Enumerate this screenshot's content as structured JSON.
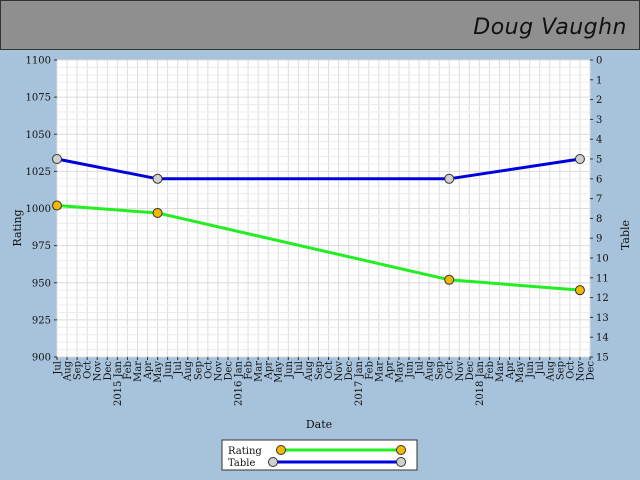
{
  "header": {
    "name": "Doug Vaughn"
  },
  "chart_data": {
    "type": "line",
    "xlabel": "Date",
    "ylabel_left": "Rating",
    "ylabel_right": "Table",
    "ylim_left": [
      900,
      1100
    ],
    "ylim_right": [
      15,
      0
    ],
    "y_left_ticks": [
      900,
      925,
      950,
      975,
      1000,
      1025,
      1050,
      1075,
      1100
    ],
    "y_right_ticks": [
      0,
      1,
      2,
      3,
      4,
      5,
      6,
      7,
      8,
      9,
      10,
      11,
      12,
      13,
      14,
      15
    ],
    "x_range": [
      "2014-07",
      "2018-12"
    ],
    "x_ticks": [
      "Jul",
      "Aug",
      "Sep",
      "Oct",
      "Nov",
      "Dec",
      "2015 Jan",
      "Feb",
      "Mar",
      "Apr",
      "May",
      "Jun",
      "Jul",
      "Aug",
      "Sep",
      "Oct",
      "Nov",
      "Dec",
      "2016 Jan",
      "Feb",
      "Mar",
      "Apr",
      "May",
      "Jun",
      "Jul",
      "Aug",
      "Sep",
      "Oct",
      "Nov",
      "Dec",
      "2017 Jan",
      "Feb",
      "Mar",
      "Apr",
      "May",
      "Jun",
      "Jul",
      "Aug",
      "Sep",
      "Oct",
      "Nov",
      "Dec",
      "2018 Jan",
      "Feb",
      "Mar",
      "Apr",
      "May",
      "Jun",
      "Jul",
      "Aug",
      "Sep",
      "Oct",
      "Nov",
      "Dec"
    ],
    "grid": true,
    "series": [
      {
        "name": "Rating",
        "axis": "left",
        "color": "#22ee22",
        "marker_color": "#f5b800",
        "x": [
          "2014-07",
          "2015-05",
          "2017-10",
          "2018-11"
        ],
        "values": [
          1002,
          997,
          952,
          945
        ]
      },
      {
        "name": "Table",
        "axis": "right",
        "color": "#0000dd",
        "marker_color": "#d0d0d0",
        "x": [
          "2014-07",
          "2015-05",
          "2017-10",
          "2018-11"
        ],
        "values": [
          5,
          6,
          6,
          5
        ]
      }
    ],
    "legend_position": "bottom-center"
  }
}
